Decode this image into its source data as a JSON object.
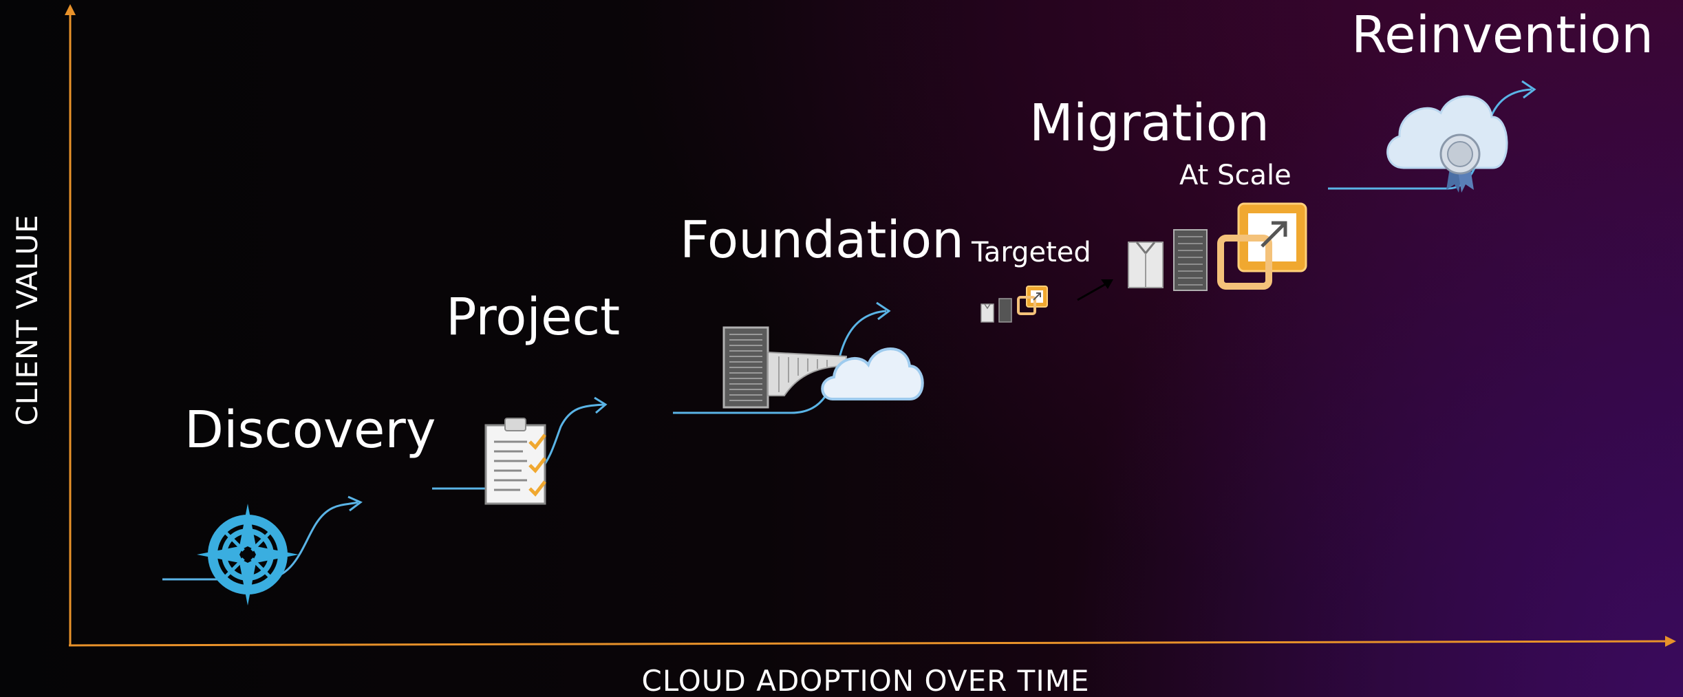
{
  "axes": {
    "y_label": "CLIENT VALUE",
    "x_label": "CLOUD ADOPTION OVER TIME",
    "color": "#e8922a"
  },
  "stages": [
    {
      "title": "Discovery",
      "icon": "compass-icon"
    },
    {
      "title": "Project",
      "icon": "clipboard-checklist-icon"
    },
    {
      "title": "Foundation",
      "icon": "server-bridge-cloud-icon"
    },
    {
      "title": "Migration",
      "icon": "servers-migration-icon",
      "sub_labels": [
        "Targeted",
        "At Scale"
      ]
    },
    {
      "title": "Reinvention",
      "icon": "cloud-award-icon"
    }
  ],
  "colors": {
    "path": "#5ab4e6",
    "compass": "#3aaee0",
    "orange": "#f0a830",
    "cloud": "#dbe9f6"
  }
}
